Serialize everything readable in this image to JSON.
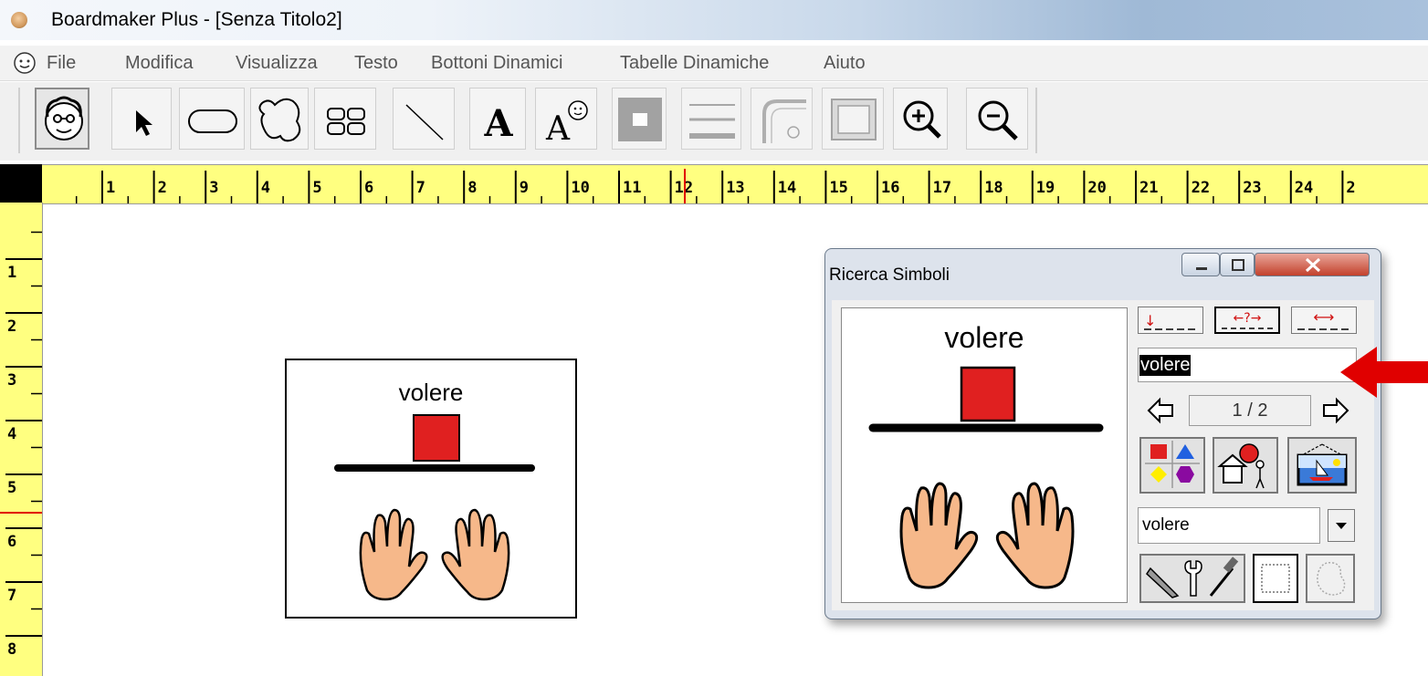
{
  "window": {
    "title": "Boardmaker Plus - [Senza Titolo2]"
  },
  "menu": {
    "items": [
      "File",
      "Modifica",
      "Visualizza",
      "Testo",
      "Bottoni Dinamici",
      "Tabelle Dinamiche",
      "Aiuto"
    ]
  },
  "toolbar": {
    "tools": [
      "symbol-finder",
      "pointer",
      "rounded-rect",
      "freeform",
      "button-grid",
      "line",
      "text",
      "symbol-text",
      "fill-color",
      "line-thickness",
      "corner-style",
      "border",
      "zoom-in",
      "zoom-out"
    ]
  },
  "ruler": {
    "horizontal": [
      "1",
      "2",
      "3",
      "4",
      "5",
      "6",
      "7",
      "8",
      "9",
      "10",
      "11",
      "12",
      "13",
      "14",
      "15",
      "16",
      "17",
      "18",
      "19",
      "20",
      "21",
      "22",
      "23",
      "24",
      "2"
    ],
    "vertical": [
      "1",
      "2",
      "3",
      "4",
      "5",
      "6",
      "7",
      "8"
    ]
  },
  "canvas": {
    "symbol_label": "volere"
  },
  "dialog": {
    "title": "Ricerca Simboli",
    "preview_label": "volere",
    "search_text": "volere",
    "page_indicator": "1 / 2",
    "category_value": "volere"
  },
  "colors": {
    "ruler": "#ffff80",
    "symbol_red": "#e02020",
    "annotation_arrow": "#e00000"
  }
}
